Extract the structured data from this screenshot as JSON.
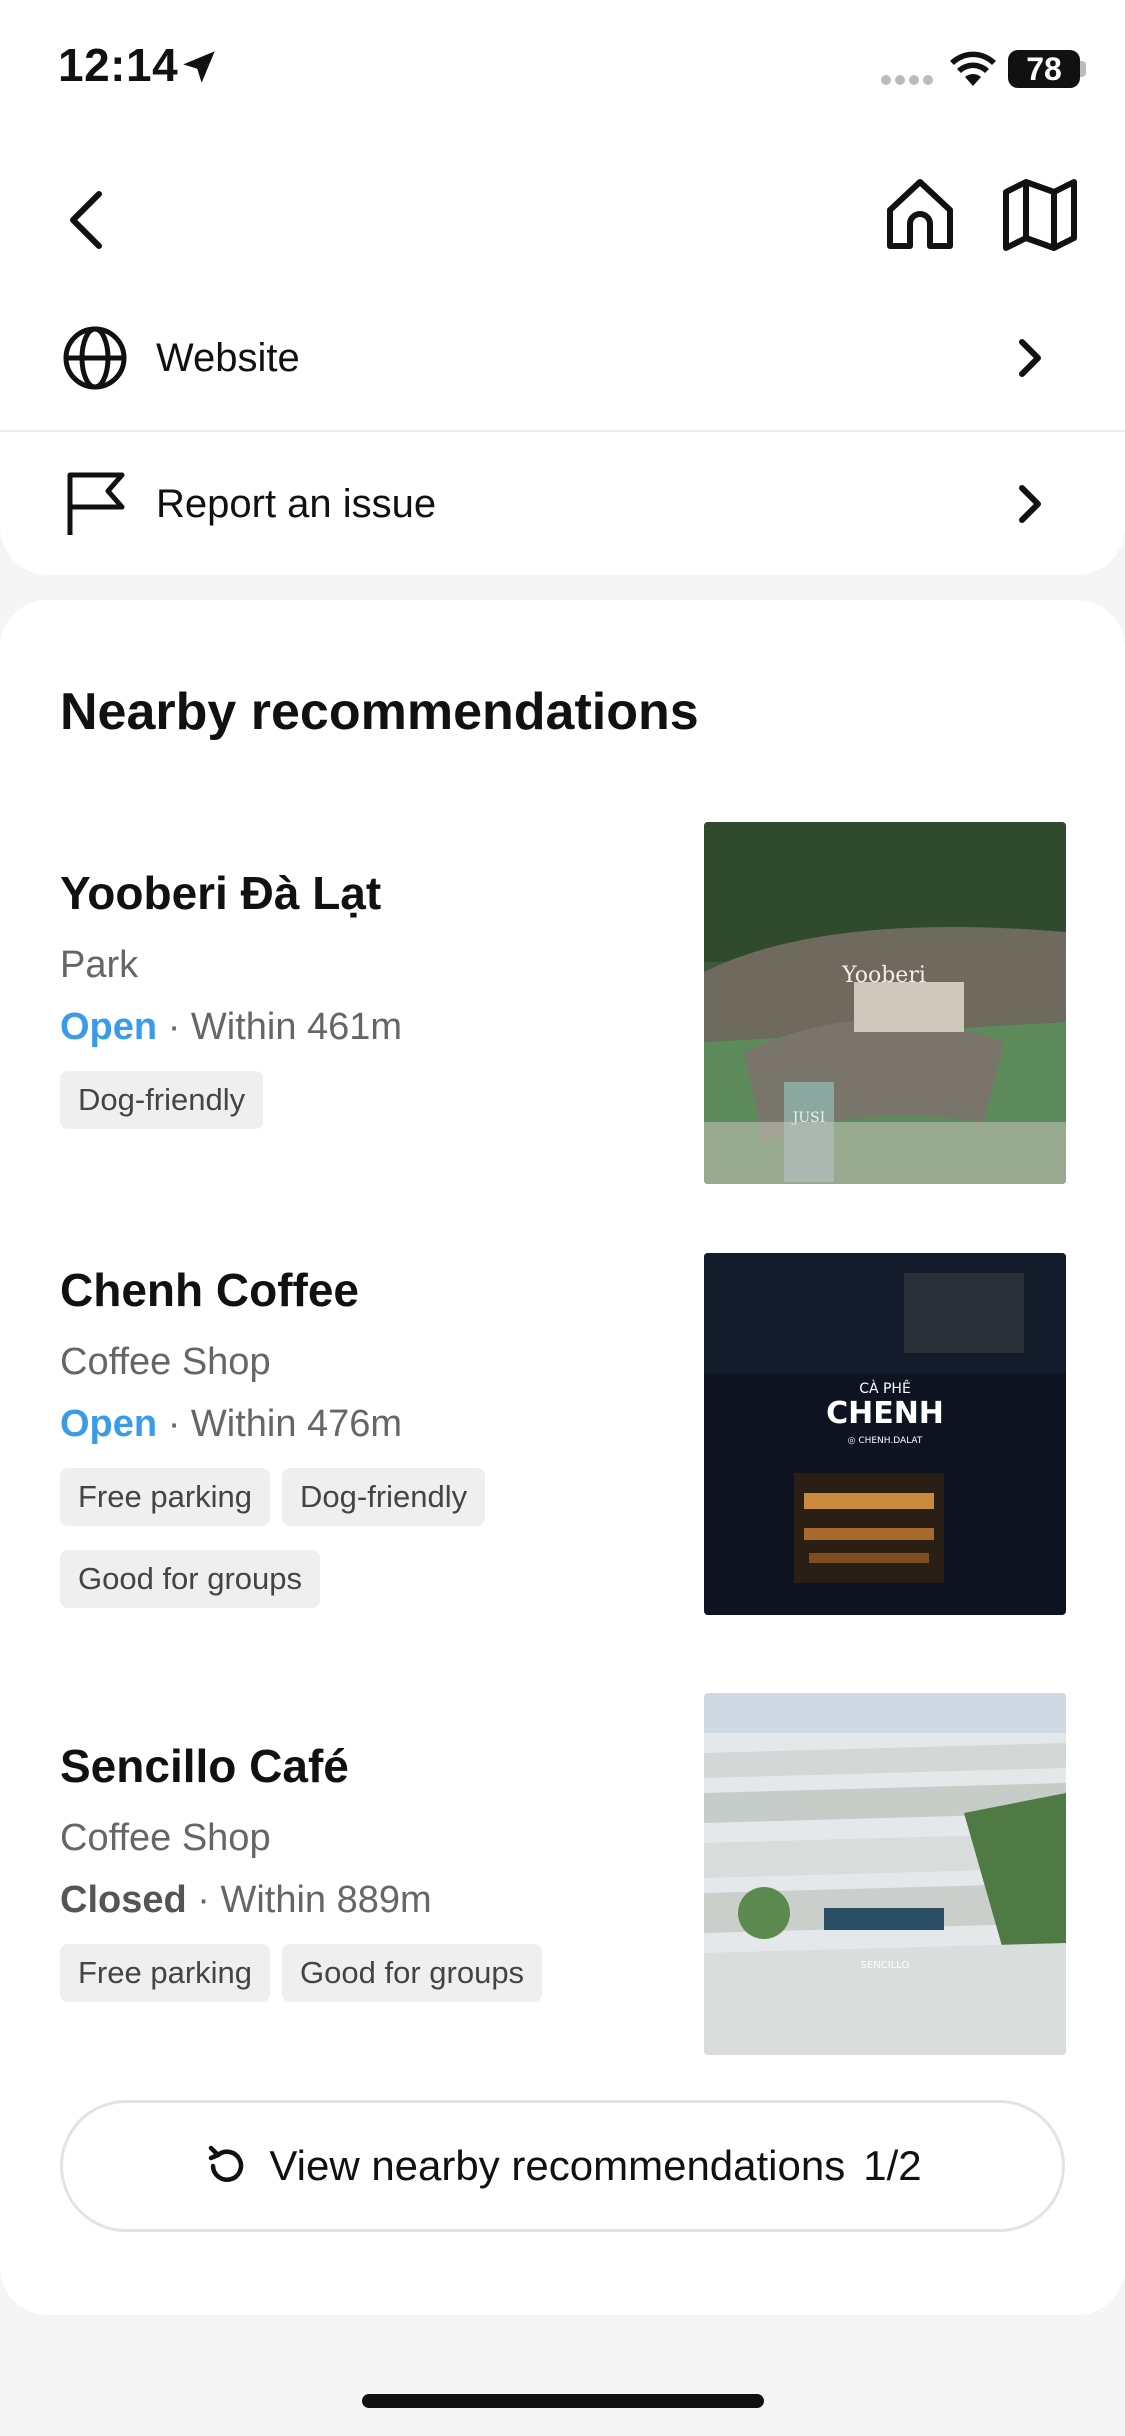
{
  "status_bar": {
    "time": "12:14",
    "battery": "78"
  },
  "header": {
    "back_icon": "chevron-left-icon",
    "home_icon": "home-icon",
    "map_icon": "map-icon"
  },
  "links": [
    {
      "label": "Website",
      "icon": "globe-icon"
    },
    {
      "label": "Report an issue",
      "icon": "flag-icon"
    }
  ],
  "recommendations": {
    "title": "Nearby recommendations",
    "places": [
      {
        "name": "Yooberi Đà Lạt",
        "category": "Park",
        "status": "Open",
        "distance": "· Within 461m",
        "tags": [
          "Dog-friendly"
        ],
        "image_text": "Yooberi",
        "image_sub": "JUSI"
      },
      {
        "name": "Chenh Coffee",
        "category": "Coffee Shop",
        "status": "Open",
        "distance": "· Within 476m",
        "tags": [
          "Free parking",
          "Dog-friendly",
          "Good for groups"
        ],
        "image_text": "CHENH",
        "image_sub": "CÀ PHÊ",
        "image_handle": "◎ CHENH.DALAT"
      },
      {
        "name": "Sencillo Café",
        "category": "Coffee Shop",
        "status": "Closed",
        "distance": "· Within 889m",
        "tags": [
          "Free parking",
          "Good for groups"
        ],
        "image_text": "SENCILLO"
      }
    ],
    "more_button": {
      "label": "View nearby recommendations",
      "page": "1/2"
    }
  },
  "colors": {
    "open": "#3a9be8",
    "closed": "#555555",
    "tag_bg": "#efefef"
  }
}
